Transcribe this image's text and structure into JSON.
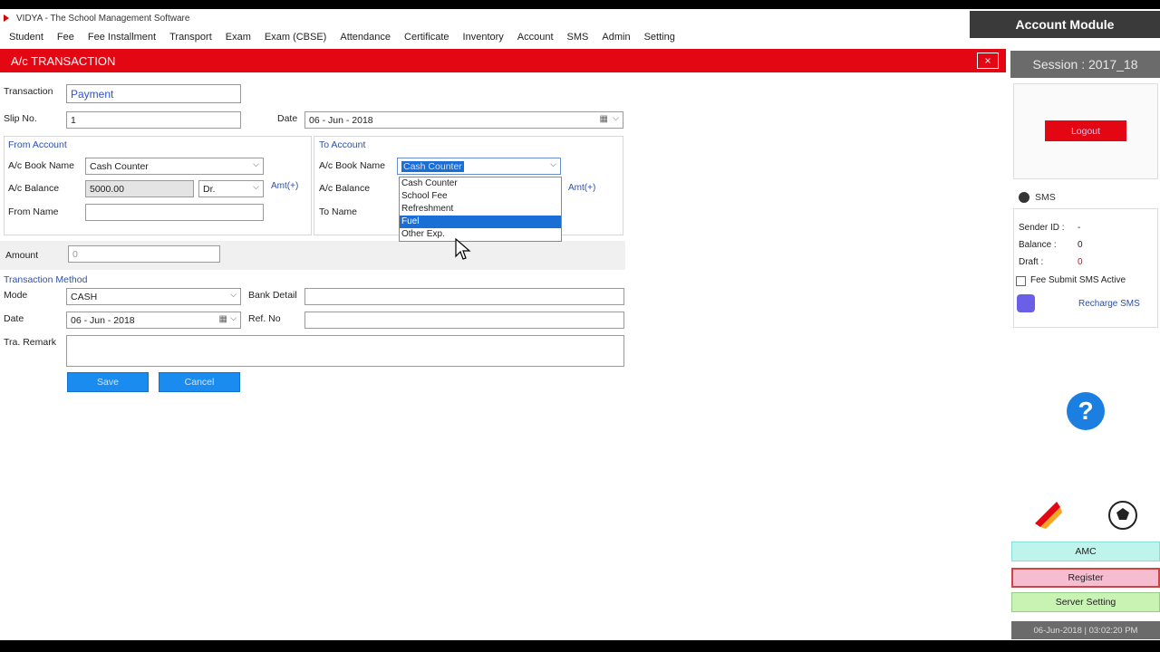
{
  "window": {
    "title": "VIDYA - The School Management Software"
  },
  "menu": [
    "Student",
    "Fee",
    "Fee Installment",
    "Transport",
    "Exam",
    "Exam (CBSE)",
    "Attendance",
    "Certificate",
    "Inventory",
    "Account",
    "SMS",
    "Admin",
    "Setting"
  ],
  "module": {
    "title": "Account Module",
    "session": "Session : 2017_18"
  },
  "header": {
    "title": "A/c TRANSACTION",
    "close": "×"
  },
  "form": {
    "transaction_label": "Transaction",
    "transaction_value": "Payment",
    "slip_label": "Slip No.",
    "slip_value": "1",
    "date_label": "Date",
    "date_value": "06 - Jun - 2018",
    "from": {
      "title": "From Account",
      "book_label": "A/c Book Name",
      "book_value": "Cash Counter",
      "balance_label": "A/c Balance",
      "balance_value": "5000.00",
      "drcr_value": "Dr.",
      "amt_label": "Amt(+)",
      "name_label": "From Name",
      "name_value": ""
    },
    "to": {
      "title": "To Account",
      "book_label": "A/c Book Name",
      "book_value": "Cash Counter",
      "balance_label": "A/c Balance",
      "amt_label": "Amt(+)",
      "name_label": "To Name",
      "options": [
        "Cash Counter",
        "School Fee",
        "Refreshment",
        "Fuel",
        "Other Exp."
      ],
      "selected_option": "Fuel"
    },
    "amount_label": "Amount",
    "amount_value": "0",
    "method_title": "Transaction Method",
    "mode_label": "Mode",
    "mode_value": "CASH",
    "bank_label": "Bank Detail",
    "bank_value": "",
    "method_date_label": "Date",
    "method_date_value": "06 - Jun - 2018",
    "ref_label": "Ref. No",
    "ref_value": "",
    "remark_label": "Tra.  Remark",
    "remark_value": "",
    "save_label": "Save",
    "cancel_label": "Cancel"
  },
  "side": {
    "logout_label": "Logout",
    "sms_title": "SMS",
    "sender_label": "Sender ID :",
    "sender_value": "-",
    "balance_label": "Balance :",
    "balance_value": "0",
    "draft_label": "Draft :",
    "draft_value": "0",
    "fee_submit_label": "Fee Submit SMS Active",
    "recharge_label": "Recharge SMS",
    "help_label": "?",
    "amc_label": "AMC",
    "register_label": "Register",
    "server_label": "Server Setting",
    "status_text": "06-Jun-2018 | 03:02:20 PM"
  },
  "colors": {
    "brand_red": "#e30613",
    "selection_blue": "#1a6fd6",
    "link_blue": "#2a4fb0"
  }
}
